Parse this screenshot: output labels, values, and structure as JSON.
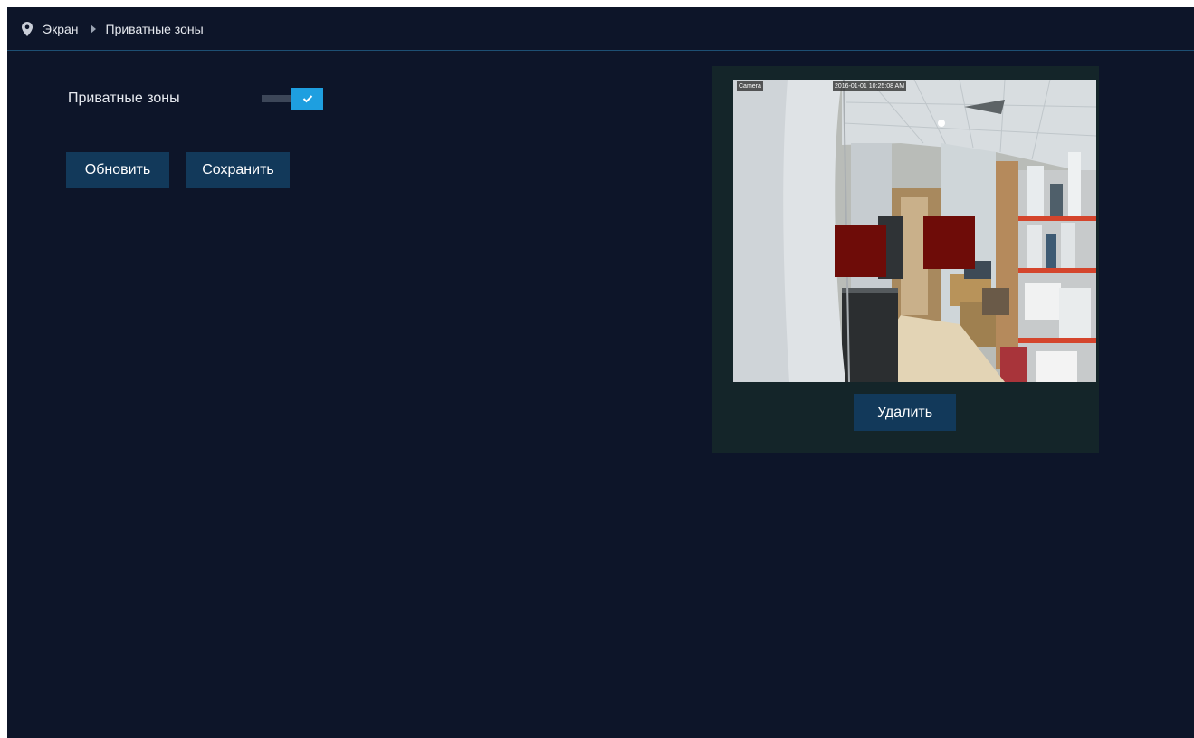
{
  "breadcrumb": {
    "items": [
      "Экран",
      "Приватные зоны"
    ],
    "icons": {
      "location": "map-pin-icon",
      "separator": "caret-right-icon"
    }
  },
  "privacy": {
    "label": "Приватные зоны",
    "enabled": true
  },
  "actions": {
    "refresh_label": "Обновить",
    "save_label": "Сохранить"
  },
  "preview": {
    "osd_name": "Camera",
    "osd_time": "2016-01-01 10:25:08 AM",
    "masks_color": "#6e0c08",
    "delete_label": "Удалить"
  },
  "colors": {
    "background": "#0d1529",
    "accent": "#1e9fe0",
    "button": "#12395a",
    "panel": "#142529"
  }
}
